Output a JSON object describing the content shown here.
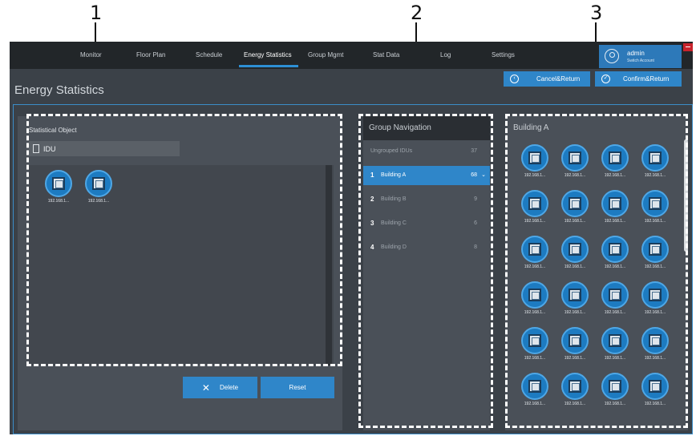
{
  "callouts": [
    "1",
    "2",
    "3"
  ],
  "nav": {
    "items": [
      "Monitor",
      "Floor Plan",
      "Schedule",
      "Energy Statistics",
      "Group Mgmt",
      "Stat Data",
      "Log",
      "Settings"
    ],
    "active": "Energy Statistics"
  },
  "user": {
    "name": "admin",
    "switch_label": "Switch Account"
  },
  "page": {
    "title": "Energy Statistics"
  },
  "actions": {
    "cancel": "Cancel&Return",
    "confirm": "Confirm&Return"
  },
  "statistical_object": {
    "title": "Statistical Object",
    "type_label": "IDU",
    "devices": [
      "192.168.1...",
      "192.168.1..."
    ],
    "delete_label": "Delete",
    "reset_label": "Reset"
  },
  "group_navigation": {
    "title": "Group Navigation",
    "ungrouped": {
      "label": "Ungrouped IDUs",
      "count": "37"
    },
    "groups": [
      {
        "num": "1",
        "name": "Building A",
        "count": "68",
        "active": true
      },
      {
        "num": "2",
        "name": "Building B",
        "count": "9",
        "active": false
      },
      {
        "num": "3",
        "name": "Building C",
        "count": "6",
        "active": false
      },
      {
        "num": "4",
        "name": "Building D",
        "count": "8",
        "active": false
      }
    ]
  },
  "building": {
    "title": "Building A",
    "devices": [
      "192.168.1...",
      "192.168.1...",
      "192.168.1...",
      "192.168.1...",
      "192.168.1...",
      "192.168.1...",
      "192.168.1...",
      "192.168.1...",
      "192.168.1...",
      "192.168.1...",
      "192.168.1...",
      "192.168.1...",
      "192.168.1...",
      "192.168.1...",
      "192.168.1...",
      "192.168.1...",
      "192.168.1...",
      "192.168.1...",
      "192.168.1...",
      "192.168.1...",
      "192.168.1...",
      "192.168.1...",
      "192.168.1...",
      "192.168.1...",
      "",
      "",
      "",
      ""
    ]
  },
  "icons": {
    "user": "user-circle-icon",
    "cancel": "back-arrow-circle-icon",
    "confirm": "check-circle-icon",
    "document": "document-icon",
    "device": "idu-unit-icon",
    "delete": "close-x-icon",
    "expand": "chevron-down-icon"
  },
  "colors": {
    "accent": "#2f86c9",
    "topbar": "#222629",
    "background": "#3b4148",
    "panel": "#4a5058",
    "close": "#c8232c"
  }
}
